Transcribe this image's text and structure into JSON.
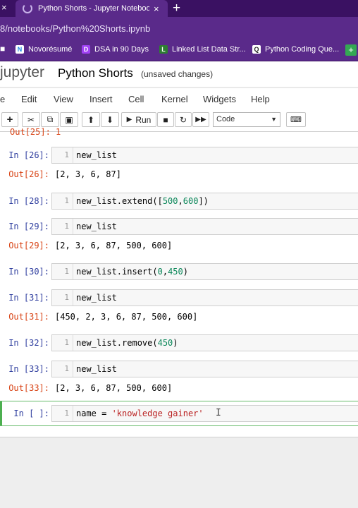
{
  "browser": {
    "tab_title": "Python Shorts - Jupyter Noteboo",
    "tab_close": "×",
    "left_close": "×",
    "new_tab": "+",
    "url": "8/notebooks/Python%20Shorts.ipynb"
  },
  "bookmarks": [
    {
      "label": "Novorésumé",
      "icon": "N"
    },
    {
      "label": "DSA in 90 Days",
      "icon": "D"
    },
    {
      "label": "Linked List Data Str...",
      "icon": "L"
    },
    {
      "label": "Python Coding Que...",
      "icon": "Q"
    }
  ],
  "colors": {
    "prompt_in": "#303f9f",
    "prompt_out": "#d84315",
    "browser_bg": "#5a2a8a",
    "active_cell": "#66bb6a"
  },
  "jupyter": {
    "logo": "jupyter",
    "notebook_title": "Python Shorts",
    "save_status": "(unsaved changes)"
  },
  "menu": [
    "e",
    "Edit",
    "View",
    "Insert",
    "Cell",
    "Kernel",
    "Widgets",
    "Help"
  ],
  "toolbar": {
    "run_label": "Run",
    "cell_type": "Code",
    "icons": [
      "plus-icon",
      "scissors-icon",
      "copy-icon",
      "paste-icon",
      "arrow-up-icon",
      "arrow-down-icon",
      "play-icon",
      "stop-icon",
      "restart-icon",
      "fast-forward-icon",
      "keyboard-icon"
    ]
  },
  "notebook": {
    "cutoff_text": "Out[25]:  1",
    "cells": [
      {
        "prompt": "In [26]:",
        "line": "1",
        "code": "new_list",
        "out_prompt": "Out[26]:",
        "output": "[2, 3, 6, 87]"
      },
      {
        "prompt": "In [28]:",
        "line": "1",
        "code": "new_list.extend([500,600])"
      },
      {
        "prompt": "In [29]:",
        "line": "1",
        "code": "new_list",
        "out_prompt": "Out[29]:",
        "output": "[2, 3, 6, 87, 500, 600]"
      },
      {
        "prompt": "In [30]:",
        "line": "1",
        "code": "new_list.insert(0,450)"
      },
      {
        "prompt": "In [31]:",
        "line": "1",
        "code": "new_list",
        "out_prompt": "Out[31]:",
        "output": "[450, 2, 3, 6, 87, 500, 600]"
      },
      {
        "prompt": "In [32]:",
        "line": "1",
        "code": "new_list.remove(450)"
      },
      {
        "prompt": "In [33]:",
        "line": "1",
        "code": "new_list",
        "out_prompt": "Out[33]:",
        "output": "[2, 3, 6, 87, 500, 600]"
      }
    ],
    "active": {
      "prompt": "In [ ]:",
      "line": "1",
      "code": "name = 'knowledge gainer'"
    }
  }
}
